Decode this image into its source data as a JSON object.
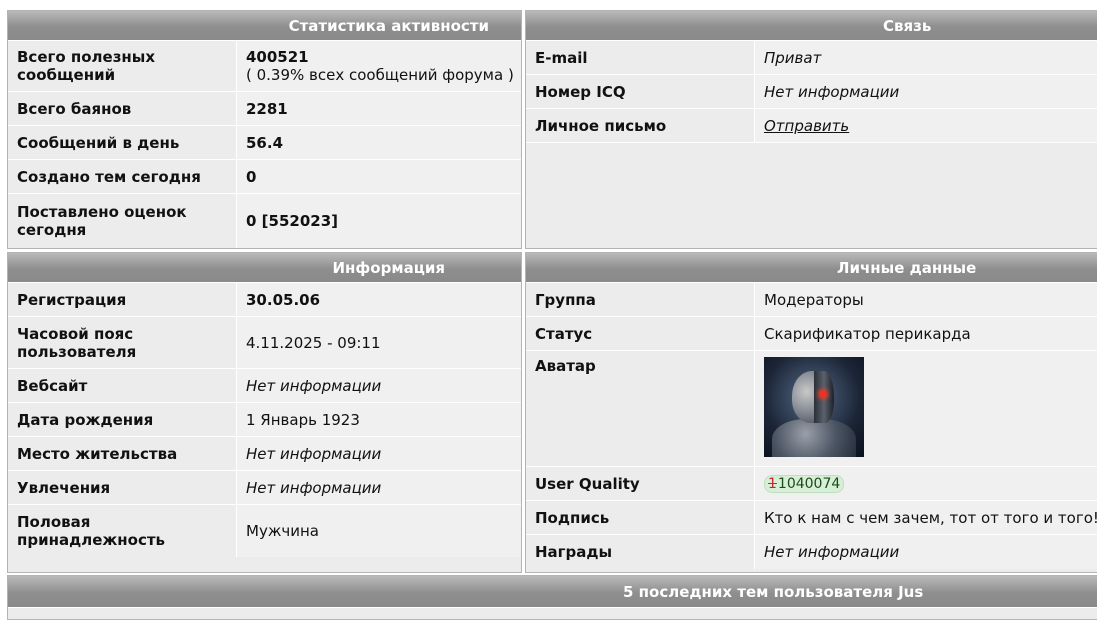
{
  "stats": {
    "title": "Статистика активности",
    "rows": [
      {
        "label": "Всего полезных сообщений",
        "value": "400521",
        "sub": "( 0.39% всех сообщений форума )"
      },
      {
        "label": "Всего баянов",
        "value": "2281"
      },
      {
        "label": "Сообщений в день",
        "value": "56.4"
      },
      {
        "label": "Создано тем сегодня",
        "value": "0"
      },
      {
        "label": "Поставлено оценок сегодня",
        "value": "0 [552023]"
      }
    ]
  },
  "contact": {
    "title": "Связь",
    "rows": [
      {
        "label": "E-mail",
        "value": "Приват"
      },
      {
        "label": "Номер ICQ",
        "value": "Нет информации"
      },
      {
        "label": "Личное письмо",
        "value": "Отправить"
      }
    ]
  },
  "info": {
    "title": "Информация",
    "rows": [
      {
        "label": "Регистрация",
        "value": "30.05.06"
      },
      {
        "label": "Часовой пояс пользователя",
        "value": "4.11.2025 - 09:11"
      },
      {
        "label": "Вебсайт",
        "value": "Нет информации"
      },
      {
        "label": "Дата рождения",
        "value": "1 Январь 1923"
      },
      {
        "label": "Место жительства",
        "value": "Нет информации"
      },
      {
        "label": "Увлечения",
        "value": "Нет информации"
      },
      {
        "label": "Половая принадлежность",
        "value": "Мужчина"
      }
    ]
  },
  "personal": {
    "title": "Личные данные",
    "rows": [
      {
        "label": "Группа",
        "value": "Модераторы"
      },
      {
        "label": "Статус",
        "value": "Скарификатор перикарда"
      },
      {
        "label": "Аватар",
        "value": ""
      },
      {
        "label": "User Quality",
        "value": "1040074",
        "prefix": "1"
      },
      {
        "label": "Подпись",
        "value": "Кто к нам с чем зачем, тот от того и того!"
      },
      {
        "label": "Награды",
        "value": "Нет информации"
      }
    ]
  },
  "topics": {
    "title": "5 последних тем пользователя Jus"
  },
  "colors": {
    "header_bg": "#8e8e8e",
    "panel_bg": "#ececec",
    "uq_badge_bg": "#d6efd6"
  }
}
